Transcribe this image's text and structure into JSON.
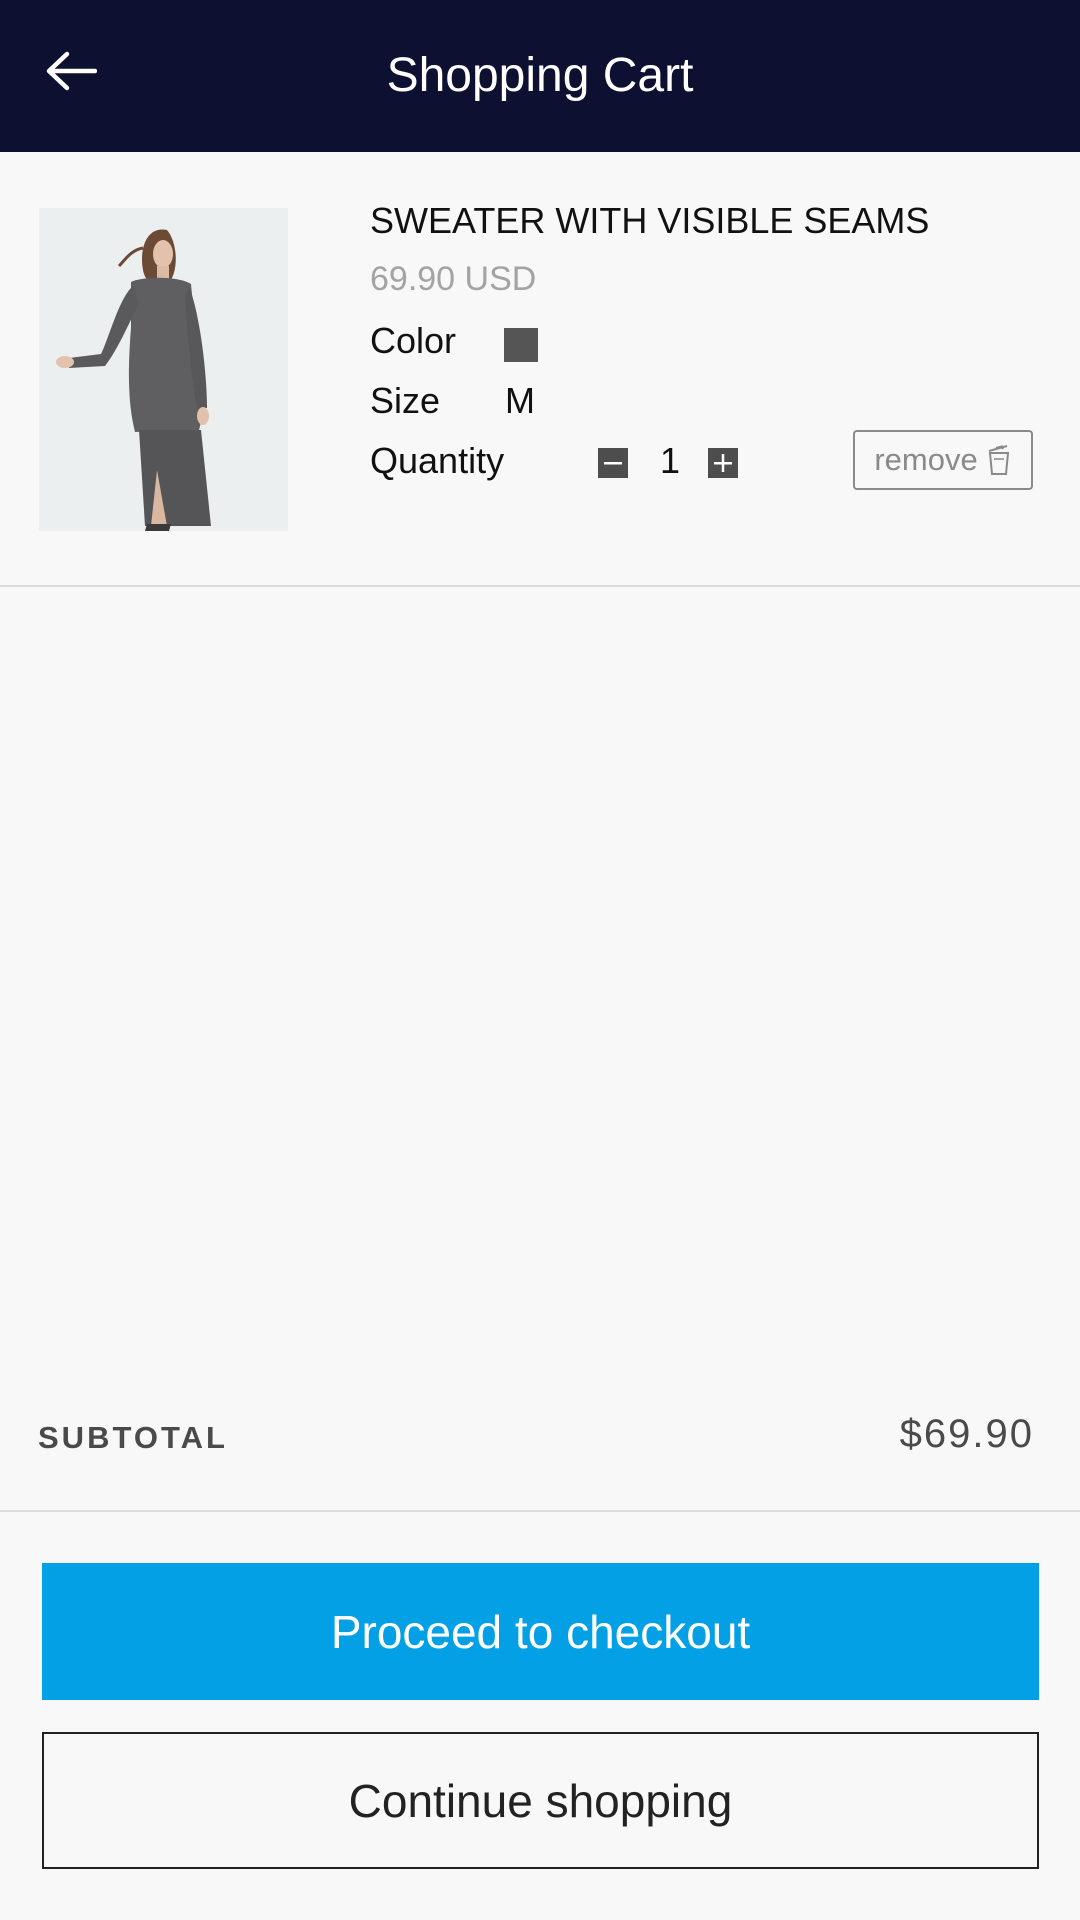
{
  "header": {
    "title": "Shopping Cart",
    "back_icon": "arrow-left-icon"
  },
  "cart": {
    "items": [
      {
        "name": "SWEATER WITH VISIBLE SEAMS",
        "price": "69.90 USD",
        "color_label": "Color",
        "color_value": "#555555",
        "size_label": "Size",
        "size_value": "M",
        "quantity_label": "Quantity",
        "quantity": "1",
        "remove_label": "remove"
      }
    ]
  },
  "summary": {
    "subtotal_label": "SUBTOTAL",
    "subtotal_value": "$69.90"
  },
  "actions": {
    "checkout_label": "Proceed to checkout",
    "continue_label": "Continue shopping"
  },
  "colors": {
    "header_bg": "#0d1030",
    "checkout_bg": "#03a0e6"
  }
}
